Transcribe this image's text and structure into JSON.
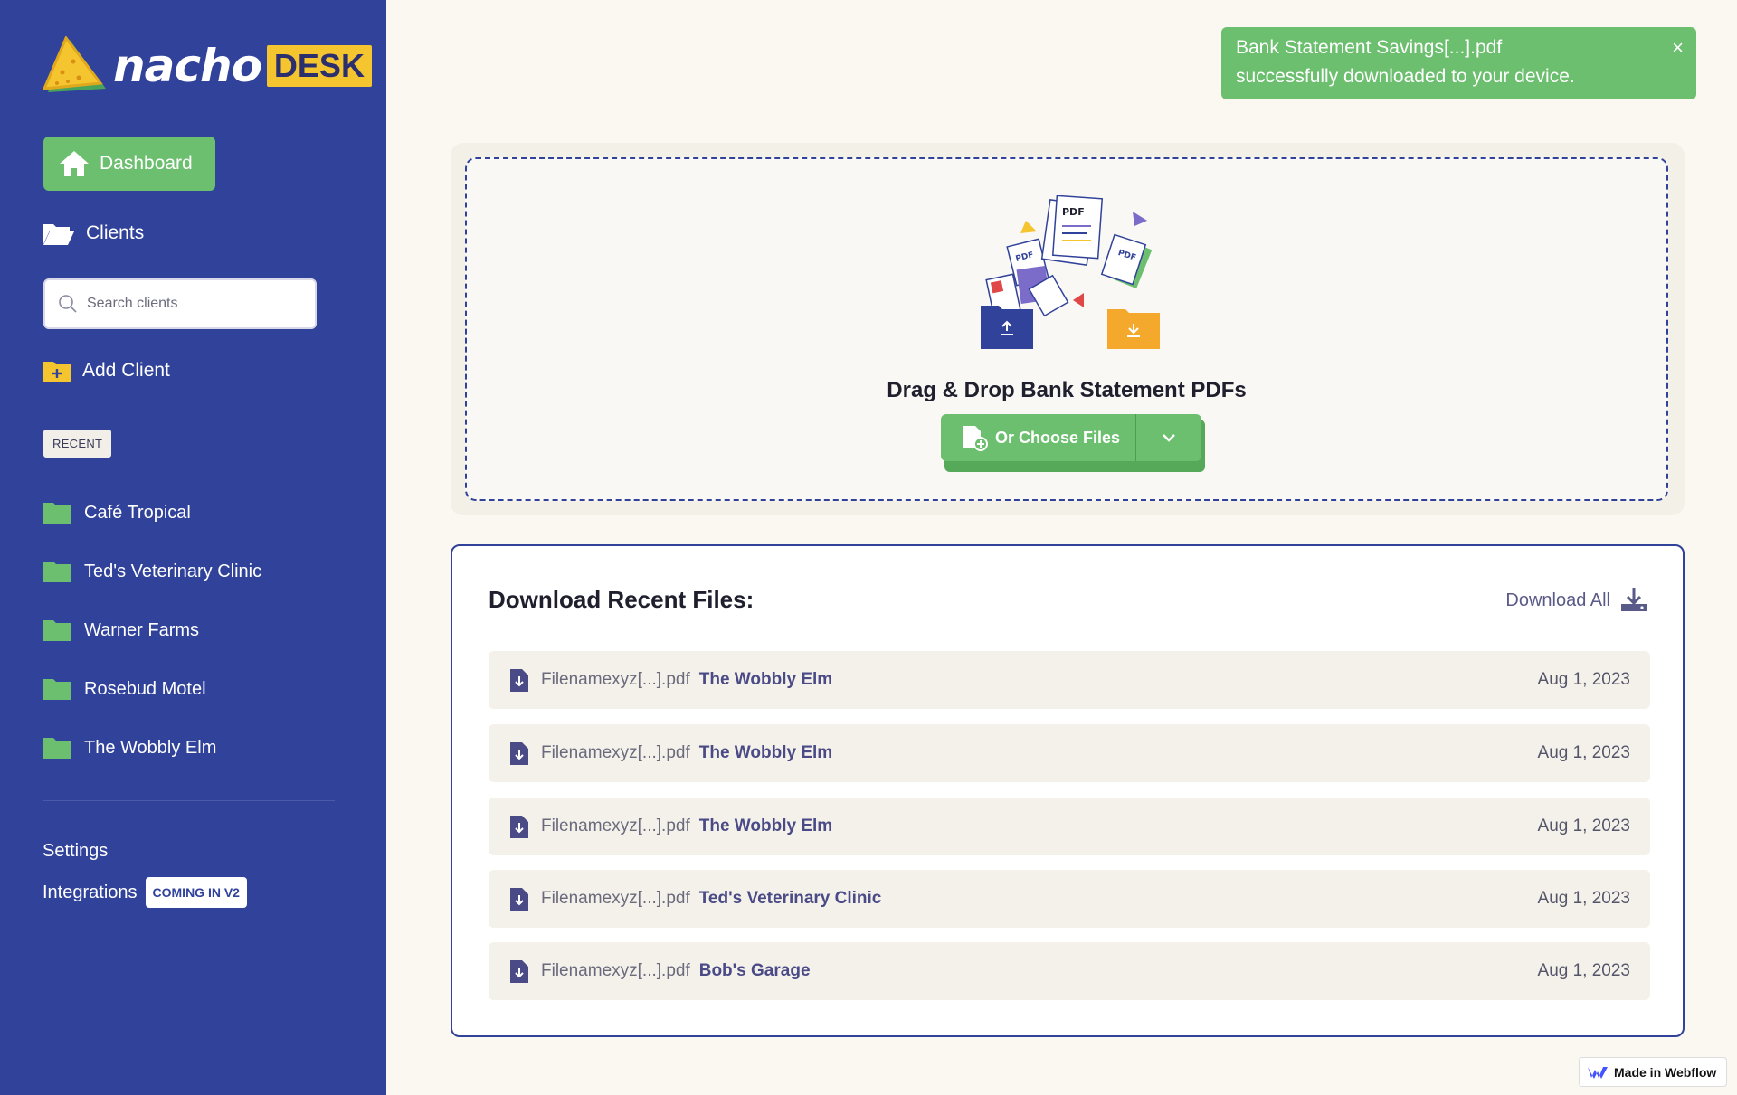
{
  "brand": {
    "name_left": "nacho",
    "name_right": "DESK"
  },
  "sidebar": {
    "dashboard_label": "Dashboard",
    "clients_label": "Clients",
    "search_placeholder": "Search clients",
    "add_client_label": "Add Client",
    "recent_label": "RECENT",
    "recent_clients": [
      "Café Tropical",
      "Ted's Veterinary Clinic",
      "Warner Farms",
      "Rosebud Motel",
      "The Wobbly Elm"
    ],
    "settings_label": "Settings",
    "integrations_label": "Integrations",
    "coming_badge": "COMING IN V2"
  },
  "toast": {
    "line1": "Bank Statement Savings[...].pdf",
    "line2": "successfully downloaded to your device.",
    "close": "×"
  },
  "upload": {
    "title": "Drag & Drop Bank Statement PDFs",
    "choose_label": "Or Choose Files",
    "illustration_label": "PDF"
  },
  "recent_files": {
    "title": "Download Recent Files:",
    "download_all": "Download All",
    "rows": [
      {
        "file": "Filenamexyz[...].pdf",
        "client": "The Wobbly Elm",
        "date": "Aug 1, 2023"
      },
      {
        "file": "Filenamexyz[...].pdf",
        "client": "The Wobbly Elm",
        "date": "Aug 1, 2023"
      },
      {
        "file": "Filenamexyz[...].pdf",
        "client": "The Wobbly Elm",
        "date": "Aug 1, 2023"
      },
      {
        "file": "Filenamexyz[...].pdf",
        "client": "Ted's Veterinary Clinic",
        "date": "Aug 1, 2023"
      },
      {
        "file": "Filenamexyz[...].pdf",
        "client": "Bob's Garage",
        "date": "Aug 1, 2023"
      }
    ]
  },
  "footer": {
    "webflow_label": "Made in Webflow"
  },
  "colors": {
    "sidebar": "#31429a",
    "accent_green": "#6bbf6e",
    "brand_yellow": "#f5c530",
    "background": "#faf8f1"
  }
}
